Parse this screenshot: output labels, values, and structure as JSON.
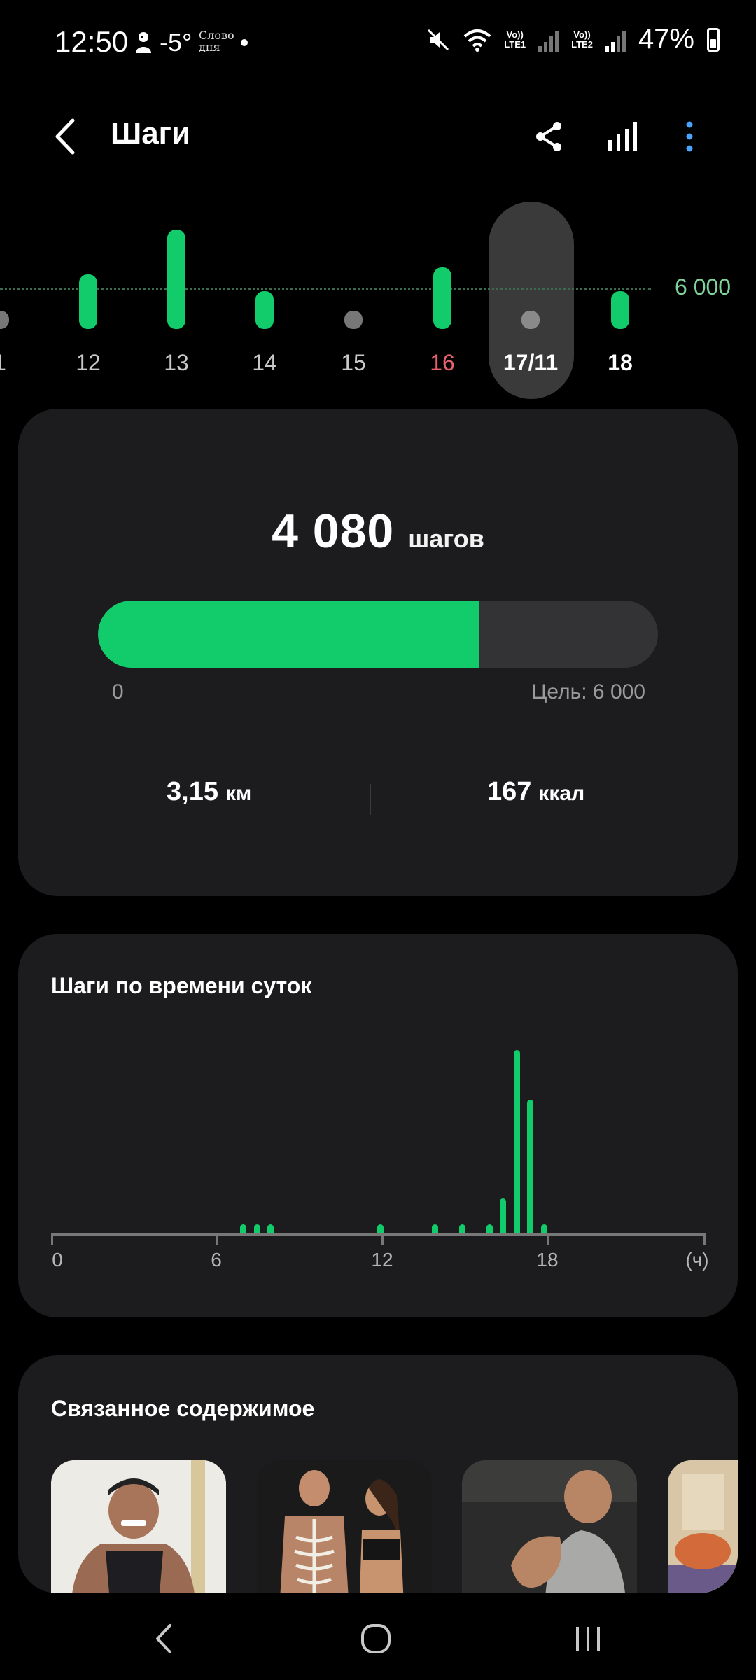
{
  "status": {
    "time": "12:50",
    "temp": "-5°",
    "brand_line1": "Слово",
    "brand_line2": "дня",
    "lte1": "Vo))",
    "lte1b": "LTE1",
    "lte2": "Vo))",
    "lte2b": "LTE2",
    "battery": "47%"
  },
  "header": {
    "title": "Шаги",
    "icons": [
      "back-arrow-icon",
      "share-icon",
      "bar-chart-icon",
      "more-vertical-icon"
    ]
  },
  "week_chart": {
    "goal_label": "6 000",
    "selected_color": "#5a5a5a",
    "days": [
      {
        "label": "1",
        "steps_fraction": 0.0,
        "color": "#777777"
      },
      {
        "label": "12",
        "steps_fraction": 0.55,
        "color": "#12cc6b"
      },
      {
        "label": "13",
        "steps_fraction": 1.0,
        "color": "#12cc6b"
      },
      {
        "label": "14",
        "steps_fraction": 0.38,
        "color": "#12cc6b"
      },
      {
        "label": "15",
        "steps_fraction": 0.0,
        "color": "#777777"
      },
      {
        "label": "16",
        "steps_fraction": 0.62,
        "color": "#12cc6b",
        "highlight": "#e8636d"
      },
      {
        "label": "17/11",
        "steps_fraction": 0.0,
        "color": "#8a8a8a",
        "selected": true
      },
      {
        "label": "18",
        "steps_fraction": 0.38,
        "color": "#12cc6b"
      }
    ]
  },
  "summary": {
    "steps": "4 080",
    "steps_unit": "шагов",
    "progress_fraction": 0.68,
    "progress_start": "0",
    "goal_text": "Цель: 6 000",
    "distance_value": "3,15",
    "distance_unit": "км",
    "calories_value": "167",
    "calories_unit": "ккал"
  },
  "hourly": {
    "title": "Шаги по времени суток",
    "tick_labels": [
      "0",
      "6",
      "12",
      "18",
      "(ч)"
    ],
    "chart_data": {
      "type": "bar",
      "xlabel": "(ч)",
      "x": [
        7,
        7.5,
        8,
        12,
        14,
        15,
        16,
        16.5,
        17,
        17.5,
        18
      ],
      "values_fraction": [
        0.05,
        0.05,
        0.05,
        0.05,
        0.05,
        0.05,
        0.05,
        0.19,
        1.0,
        0.73,
        0.05
      ],
      "xlim": [
        0,
        24
      ],
      "color": "#12cc6b"
    }
  },
  "related": {
    "title": "Связанное содержимое",
    "items": [
      "Bodybuilder photo",
      "Anatomy couple photo",
      "Gym training photo",
      "Yoga photo"
    ]
  },
  "nav": {
    "buttons": [
      "back-nav-icon",
      "home-nav-icon",
      "recents-nav-icon"
    ]
  }
}
